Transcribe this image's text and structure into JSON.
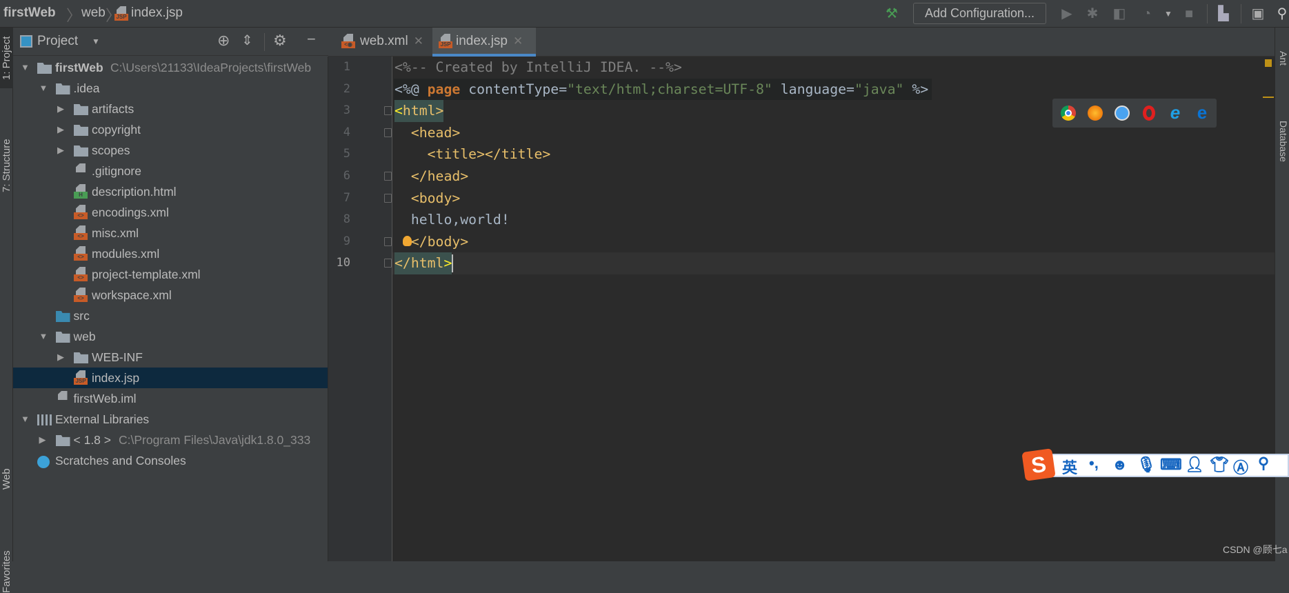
{
  "breadcrumb": {
    "project": "firstWeb",
    "folder": "web",
    "file": "index.jsp",
    "file_badge": "JSP"
  },
  "toolbar": {
    "add_configuration": "Add Configuration...",
    "icons": [
      "hammer-icon",
      "run-icon",
      "debug-icon",
      "coverage-icon",
      "profile-icon",
      "dropdown-icon",
      "stop-icon",
      "project-structure-icon",
      "run-anything-icon",
      "search-icon"
    ]
  },
  "left_stripe": {
    "project": "1: Project",
    "structure": "7: Structure",
    "web": "Web",
    "favorites": "Favorites"
  },
  "right_stripe": {
    "ant": "Ant",
    "database": "Database"
  },
  "project_panel": {
    "title": "Project"
  },
  "tree": [
    {
      "label": "firstWeb",
      "extra": "C:\\Users\\21133\\IdeaProjects\\firstWeb",
      "level": 0,
      "arrow": "down",
      "icon": "module",
      "bold": true
    },
    {
      "label": ".idea",
      "level": 1,
      "arrow": "down",
      "icon": "folder"
    },
    {
      "label": "artifacts",
      "level": 2,
      "arrow": "right",
      "icon": "folder"
    },
    {
      "label": "copyright",
      "level": 2,
      "arrow": "right",
      "icon": "folder"
    },
    {
      "label": "scopes",
      "level": 2,
      "arrow": "right",
      "icon": "folder"
    },
    {
      "label": ".gitignore",
      "level": 2,
      "icon": "ignore-file"
    },
    {
      "label": "description.html",
      "level": 2,
      "icon": "html-file",
      "badge": "H"
    },
    {
      "label": "encodings.xml",
      "level": 2,
      "icon": "xml-file",
      "badge": "<>"
    },
    {
      "label": "misc.xml",
      "level": 2,
      "icon": "xml-file",
      "badge": "<>"
    },
    {
      "label": "modules.xml",
      "level": 2,
      "icon": "xml-file",
      "badge": "<>"
    },
    {
      "label": "project-template.xml",
      "level": 2,
      "icon": "xml-file",
      "badge": "<>"
    },
    {
      "label": "workspace.xml",
      "level": 2,
      "icon": "xml-file",
      "badge": "<>"
    },
    {
      "label": "src",
      "level": 1,
      "icon": "source-folder"
    },
    {
      "label": "web",
      "level": 1,
      "arrow": "down",
      "icon": "web-folder"
    },
    {
      "label": "WEB-INF",
      "level": 2,
      "arrow": "right",
      "icon": "folder"
    },
    {
      "label": "index.jsp",
      "level": 2,
      "icon": "jsp-file",
      "badge": "JSP",
      "selected": true
    },
    {
      "label": "firstWeb.iml",
      "level": 1,
      "icon": "iml-file"
    },
    {
      "label": "External Libraries",
      "level": 0,
      "arrow": "down",
      "icon": "libraries"
    },
    {
      "label": "< 1.8 >",
      "extra": "C:\\Program Files\\Java\\jdk1.8.0_333",
      "level": 1,
      "arrow": "right",
      "icon": "jdk"
    },
    {
      "label": "Scratches and Consoles",
      "level": 0,
      "icon": "scratches"
    }
  ],
  "tabs": [
    {
      "label": "web.xml",
      "active": false
    },
    {
      "label": "index.jsp",
      "active": true
    }
  ],
  "editor": {
    "line_numbers": [
      "1",
      "2",
      "3",
      "4",
      "5",
      "6",
      "7",
      "8",
      "9",
      "10"
    ],
    "lines": [
      [
        [
          "c",
          "<%-- Created by IntelliJ IDEA. --%>"
        ]
      ],
      [
        [
          "p",
          "<%@ "
        ],
        [
          "k",
          "page"
        ],
        [
          "p",
          " contentType="
        ],
        [
          "s",
          "\"text/html;charset=UTF-8\""
        ],
        [
          "p",
          " language="
        ],
        [
          "s",
          "\"java\""
        ],
        [
          "p",
          " %>"
        ]
      ],
      [
        [
          "y",
          "<"
        ],
        [
          "t",
          "html>"
        ]
      ],
      [
        [
          "p",
          "  "
        ],
        [
          "t",
          "<head>"
        ]
      ],
      [
        [
          "p",
          "    "
        ],
        [
          "t",
          "<title></title>"
        ]
      ],
      [
        [
          "p",
          "  "
        ],
        [
          "t",
          "</head>"
        ]
      ],
      [
        [
          "p",
          "  "
        ],
        [
          "t",
          "<body>"
        ]
      ],
      [
        [
          "p",
          "  hello,world!"
        ]
      ],
      [
        [
          "p",
          "  "
        ],
        [
          "t",
          "</body>"
        ]
      ],
      [
        [
          "t",
          "</html"
        ],
        [
          "y",
          ">"
        ]
      ]
    ],
    "current_line": "10"
  },
  "browser_popup": [
    "chrome-icon",
    "firefox-icon",
    "safari-icon",
    "opera-icon",
    "ie-icon",
    "edge-icon"
  ],
  "ime_bar": {
    "logo": "S",
    "mode": "英",
    "punct": "•,",
    "icons": [
      "emoji-icon",
      "microphone-icon",
      "keyboard-icon",
      "service-icon",
      "skin-icon",
      "translate-icon",
      "search-icon"
    ]
  },
  "watermark": "CSDN @顾七a",
  "colors": {
    "accent": "#4a88c7",
    "selection": "#0d293e",
    "tag": "#e8bf6a",
    "string": "#6a8759",
    "keyword": "#cc7832",
    "comment": "#808080"
  }
}
